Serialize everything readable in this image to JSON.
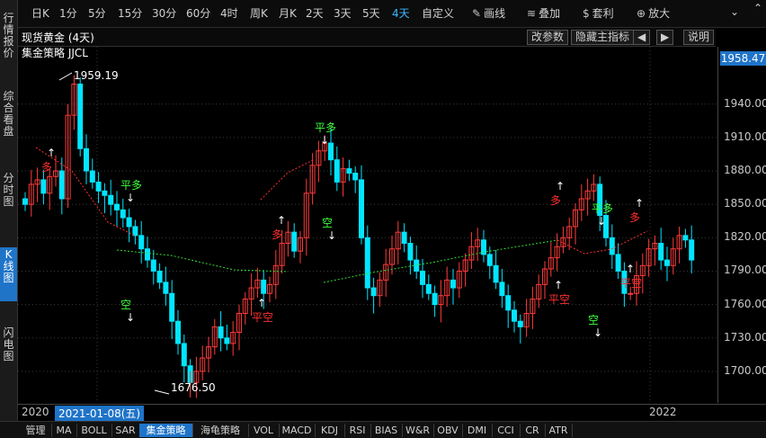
{
  "toolbar": {
    "items": [
      "日K",
      "1分",
      "5分",
      "15分",
      "30分",
      "60分",
      "4时",
      "周K",
      "月K",
      "2天",
      "3天",
      "5天",
      "4天",
      "自定义",
      "画线",
      "叠加",
      "套利",
      "放大"
    ],
    "active_index": 12
  },
  "sidebar": {
    "items": [
      "行情报价",
      "综合看盘",
      "分时图",
      "K线图",
      "闪电图"
    ],
    "active_index": 3
  },
  "header": {
    "title": "现货黄金 (4天)",
    "buttons": [
      "改参数",
      "隐藏主指标",
      "◀",
      "▶",
      "说明"
    ]
  },
  "chart": {
    "indicator_label": "集金策略 JJCL",
    "high_label": "1959.19",
    "low_label": "1676.50",
    "current_price": "1958.47",
    "ymin": 1676.5,
    "ymax": 1959.19,
    "yticks": [
      "1940.00",
      "1910.00",
      "1880.00",
      "1850.00",
      "1820.00",
      "1790.00",
      "1760.00",
      "1730.00",
      "1700.00"
    ],
    "signals": [
      {
        "text": "多",
        "color": "#ff3030"
      },
      {
        "text": "平多",
        "color": "#3cff3c"
      },
      {
        "text": "空",
        "color": "#3cff3c"
      },
      {
        "text": "平空",
        "color": "#ff3030"
      },
      {
        "text": "多",
        "color": "#ff3030"
      },
      {
        "text": "平多",
        "color": "#3cff3c"
      },
      {
        "text": "空",
        "color": "#3cff3c"
      },
      {
        "text": "多",
        "color": "#ff3030"
      },
      {
        "text": "平空",
        "color": "#ff3030"
      },
      {
        "text": "平多",
        "color": "#3cff3c"
      },
      {
        "text": "空",
        "color": "#3cff3c"
      },
      {
        "text": "多",
        "color": "#ff3030"
      },
      {
        "text": "平空",
        "color": "#ff3030"
      }
    ],
    "colors": {
      "up": "#ff3b3b",
      "down": "#00e5ff",
      "accent": "#1f74c8",
      "ma_green": "#33dd33",
      "ma_red": "#ff3030"
    }
  },
  "xaxis": {
    "start_label": "2020",
    "cursor_date": "2021-01-08(五)",
    "end_label": "2022"
  },
  "tabs": {
    "items": [
      "管理",
      "MA",
      "BOLL",
      "SAR",
      "集金策略",
      "海龟策略",
      "VOL",
      "MACD",
      "KDJ",
      "RSI",
      "BIAS",
      "W&R",
      "OBV",
      "DMI",
      "CCI",
      "CR",
      "ATR"
    ],
    "active_index": 4
  }
}
